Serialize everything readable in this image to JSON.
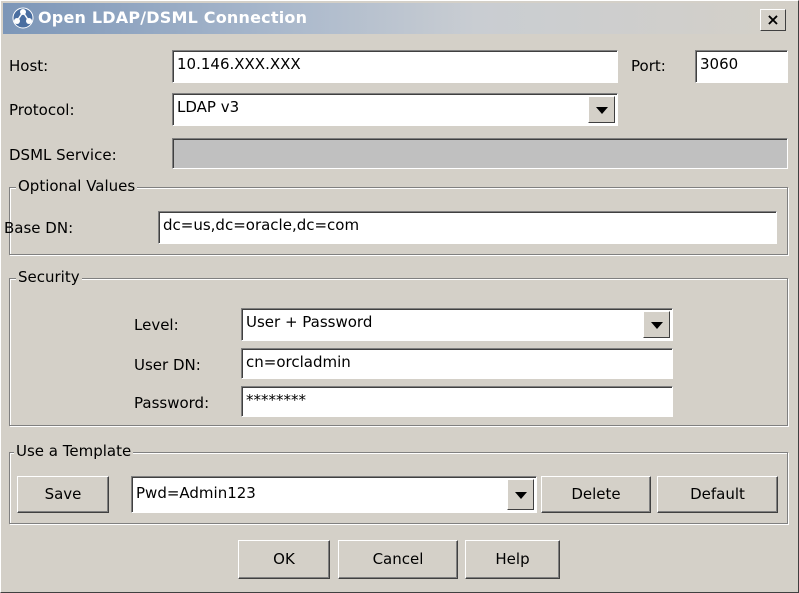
{
  "window": {
    "title": "Open LDAP/DSML Connection",
    "close_label": "×"
  },
  "connection": {
    "host_label": "Host:",
    "host_value": "10.146.XXX.XXX",
    "port_label": "Port:",
    "port_value": "3060",
    "protocol_label": "Protocol:",
    "protocol_value": "LDAP v3",
    "dsml_label": "DSML Service:",
    "dsml_value": ""
  },
  "optional": {
    "title": "Optional Values",
    "base_dn_label": "Base DN:",
    "base_dn_value": "dc=us,dc=oracle,dc=com"
  },
  "security": {
    "title": "Security",
    "level_label": "Level:",
    "level_value": "User + Password",
    "user_dn_label": "User DN:",
    "user_dn_value": "cn=orcladmin",
    "password_label": "Password:",
    "password_value": "********"
  },
  "template": {
    "title": "Use a Template",
    "save_label": "Save",
    "template_value": "Pwd=Admin123",
    "delete_label": "Delete",
    "default_label": "Default"
  },
  "footer": {
    "ok_label": "OK",
    "cancel_label": "Cancel",
    "help_label": "Help"
  }
}
